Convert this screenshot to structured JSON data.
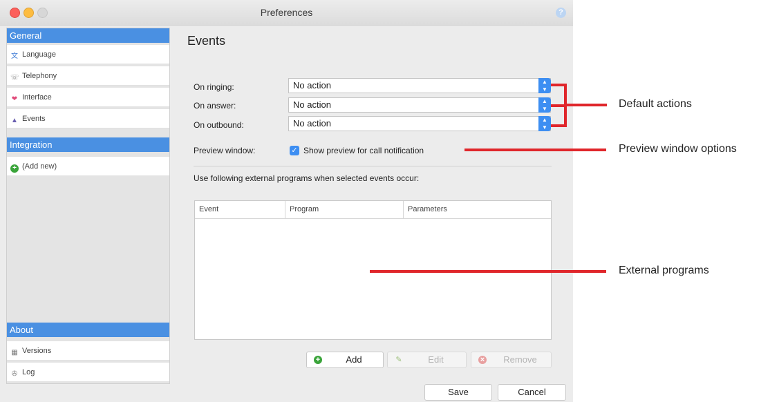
{
  "window": {
    "title": "Preferences",
    "help_label": "?"
  },
  "sidebar": {
    "general_header": "General",
    "general_items": [
      {
        "label": "Language",
        "icon": "language-icon"
      },
      {
        "label": "Telephony",
        "icon": "telephony-icon"
      },
      {
        "label": "Interface",
        "icon": "interface-icon"
      },
      {
        "label": "Events",
        "icon": "events-icon"
      }
    ],
    "integration_header": "Integration",
    "integration_items": [
      {
        "label": "(Add new)",
        "icon": "add-icon"
      }
    ],
    "about_header": "About",
    "about_items": [
      {
        "label": "Versions",
        "icon": "versions-icon"
      },
      {
        "label": "Log",
        "icon": "log-icon"
      }
    ]
  },
  "content": {
    "title": "Events",
    "on_ringing_label": "On ringing:",
    "on_ringing_value": "No action",
    "on_answer_label": "On answer:",
    "on_answer_value": "No action",
    "on_outbound_label": "On outbound:",
    "on_outbound_value": "No action",
    "preview_label": "Preview window:",
    "preview_checkbox_label": "Show preview for call notification",
    "preview_checked": true,
    "external_text": "Use following external programs when selected events occur:",
    "table_columns": [
      "Event",
      "Program",
      "Parameters"
    ],
    "table_rows": [],
    "add_label": "Add",
    "edit_label": "Edit",
    "remove_label": "Remove"
  },
  "footer": {
    "save_label": "Save",
    "cancel_label": "Cancel"
  },
  "annotations": {
    "default_actions": "Default actions",
    "preview_options": "Preview window options",
    "external_programs": "External programs"
  },
  "colors": {
    "accent": "#4a90e2",
    "annotation_red": "#e0262b"
  }
}
